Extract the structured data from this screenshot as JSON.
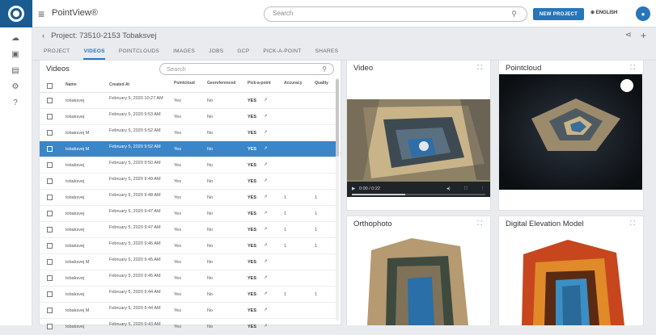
{
  "app": {
    "name": "PointView®",
    "search_placeholder": "Search",
    "new_project": "NEW PROJECT",
    "language": "ENGLISH"
  },
  "project": {
    "title": "Project: 73510-2153 Tobaksvej"
  },
  "tabs": [
    "PROJECT",
    "VIDEOS",
    "POINTCLOUDS",
    "IMAGES",
    "JOBS",
    "GCP",
    "PICK-A-POINT",
    "SHARES"
  ],
  "active_tab": "VIDEOS",
  "videos": {
    "title": "Videos",
    "search_placeholder": "Search",
    "columns": [
      "Name",
      "Created At",
      "Pointcloud",
      "Georeferenced",
      "Pick-a-point",
      "Accuracy",
      "Quality"
    ],
    "rows": [
      {
        "name": "tobaksvej",
        "created": "February 5, 2020 10:27 AM",
        "pointcloud": "Yes",
        "geo": "No",
        "pick": "YES",
        "accuracy": "",
        "quality": ""
      },
      {
        "name": "tobaksvej",
        "created": "February 5, 2020 9:53 AM",
        "pointcloud": "Yes",
        "geo": "No",
        "pick": "YES",
        "accuracy": "",
        "quality": ""
      },
      {
        "name": "tobaksvej M",
        "created": "February 5, 2020 9:52 AM",
        "pointcloud": "Yes",
        "geo": "No",
        "pick": "YES",
        "accuracy": "",
        "quality": ""
      },
      {
        "name": "tobaksvej M",
        "created": "February 5, 2020 9:52 AM",
        "pointcloud": "Yes",
        "geo": "No",
        "pick": "YES",
        "accuracy": "",
        "quality": "",
        "selected": true
      },
      {
        "name": "tobaksvej",
        "created": "February 5, 2020 9:50 AM",
        "pointcloud": "Yes",
        "geo": "No",
        "pick": "YES",
        "accuracy": "",
        "quality": ""
      },
      {
        "name": "tobaksvej",
        "created": "February 5, 2020 9:49 AM",
        "pointcloud": "Yes",
        "geo": "No",
        "pick": "YES",
        "accuracy": "",
        "quality": ""
      },
      {
        "name": "tobaksvej",
        "created": "February 5, 2020 9:48 AM",
        "pointcloud": "Yes",
        "geo": "No",
        "pick": "YES",
        "accuracy": "1",
        "quality": "1"
      },
      {
        "name": "tobaksvej",
        "created": "February 5, 2020 9:47 AM",
        "pointcloud": "Yes",
        "geo": "No",
        "pick": "YES",
        "accuracy": "1",
        "quality": "1"
      },
      {
        "name": "tobaksvej",
        "created": "February 5, 2020 9:47 AM",
        "pointcloud": "Yes",
        "geo": "No",
        "pick": "YES",
        "accuracy": "1",
        "quality": "1"
      },
      {
        "name": "tobaksvej",
        "created": "February 5, 2020 9:46 AM",
        "pointcloud": "Yes",
        "geo": "No",
        "pick": "YES",
        "accuracy": "1",
        "quality": "1"
      },
      {
        "name": "tobaksvej M",
        "created": "February 5, 2020 9:45 AM",
        "pointcloud": "Yes",
        "geo": "No",
        "pick": "YES",
        "accuracy": "",
        "quality": ""
      },
      {
        "name": "tobaksvej",
        "created": "February 5, 2020 9:45 AM",
        "pointcloud": "Yes",
        "geo": "No",
        "pick": "YES",
        "accuracy": "",
        "quality": ""
      },
      {
        "name": "tobaksvej",
        "created": "February 5, 2020 9:44 AM",
        "pointcloud": "Yes",
        "geo": "No",
        "pick": "YES",
        "accuracy": "1",
        "quality": "1"
      },
      {
        "name": "tobaksvej M",
        "created": "February 5, 2020 9:44 AM",
        "pointcloud": "Yes",
        "geo": "No",
        "pick": "YES",
        "accuracy": "",
        "quality": ""
      },
      {
        "name": "tobaksvej",
        "created": "February 5, 2020 9:43 AM",
        "pointcloud": "Yes",
        "geo": "No",
        "pick": "YES",
        "accuracy": "",
        "quality": ""
      }
    ]
  },
  "cards": {
    "video": {
      "title": "Video",
      "time": "0:00 / 0:22"
    },
    "pointcloud": {
      "title": "Pointcloud"
    },
    "orthophoto": {
      "title": "Orthophoto"
    },
    "dem": {
      "title": "Digital Elevation Model"
    }
  },
  "colors": {
    "accent": "#2875b8",
    "selected_row": "#3a86c9"
  }
}
